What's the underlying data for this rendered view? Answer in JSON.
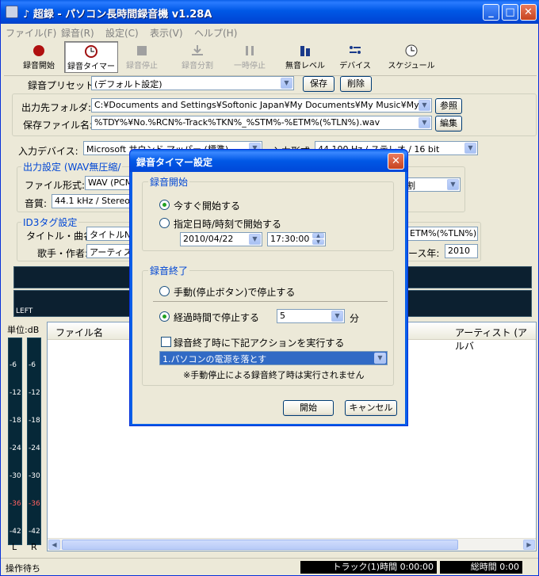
{
  "window": {
    "title": "♪ 超録 - パソコン長時間録音機 v1.28A"
  },
  "menu": [
    "ファイル(F)",
    "録音(R)",
    "設定(C)",
    "表示(V)",
    "ヘルプ(H)"
  ],
  "toolbar": {
    "rec_start": "録音開始",
    "rec_timer": "録音タイマー",
    "rec_stop": "録音停止",
    "rec_split": "録音分割",
    "pause": "一時停止",
    "silence_level": "無音レベル",
    "device": "デバイス",
    "schedule": "スケジュール"
  },
  "preset": {
    "label": "録音プリセット:",
    "value": "(デフォルト設定)",
    "save": "保存",
    "delete": "削除"
  },
  "output": {
    "folder_label": "出力先フォルダ:",
    "folder_value": "C:¥Documents and Settings¥Softonic Japan¥My Documents¥My Music¥My I",
    "browse": "参照",
    "file_label": "保存ファイル名:",
    "file_value": "%TDY%¥No.%RCN%-Track%TKN%_%STM%-%ETM%(%TLN%).wav",
    "edit": "編集"
  },
  "input": {
    "device_label": "入力デバイス:",
    "device_value": "Microsoft サウンド マッパー (標準)",
    "format_label": "入力形式:",
    "format_value": "44,100 Hz / ステレオ / 16 bit"
  },
  "output_settings": {
    "group": "出力設定 (WAV無圧縮/",
    "format_label": "ファイル形式:",
    "format_value": "WAV (PCM",
    "quality_label": "音質:",
    "quality_value": "44.1 kHz / Stereo",
    "split_value": "割"
  },
  "id3": {
    "group": "ID3タグ設定",
    "title_label": "タイトル・曲名:",
    "title_value": "タイトルNo",
    "artist_label": "歌手・作者:",
    "artist_value": "アーティス",
    "right_value": "ETM%(%TLN%)",
    "year_label": "ース年:",
    "year_value": "2010"
  },
  "meter": {
    "left_label": "LEFT"
  },
  "vu": {
    "unit": "単位:dB",
    "ticks": [
      "-6",
      "-12",
      "-18",
      "-24",
      "-30",
      "-36",
      "-42"
    ],
    "l": "L",
    "r": "R"
  },
  "list": {
    "col_filename": "ファイル名",
    "col_artist": "アーティスト (アルバ"
  },
  "status": {
    "text": "操作待ち",
    "track_time": "トラック(1)時間 0:00:00",
    "total_time": "総時間 0:00"
  },
  "dialog": {
    "title": "録音タイマー設定",
    "start_group": "録音開始",
    "start_now": "今すぐ開始する",
    "start_at": "指定日時/時刻で開始する",
    "date": "2010/04/22",
    "time": "17:30:00",
    "end_group": "録音終了",
    "end_manual": "手動(停止ボタン)で停止する",
    "end_elapsed": "経過時間で停止する",
    "minutes": "5",
    "minutes_unit": "分",
    "action_check": "録音終了時に下記アクションを実行する",
    "action_value": "1.パソコンの電源を落とす",
    "note": "※手動停止による録音終了時は実行されません",
    "start_btn": "開始",
    "cancel_btn": "キャンセル"
  },
  "colors": {
    "accent": "#0046d5",
    "titlebar": "#0058e6",
    "meter_bg": "#0c2030"
  }
}
